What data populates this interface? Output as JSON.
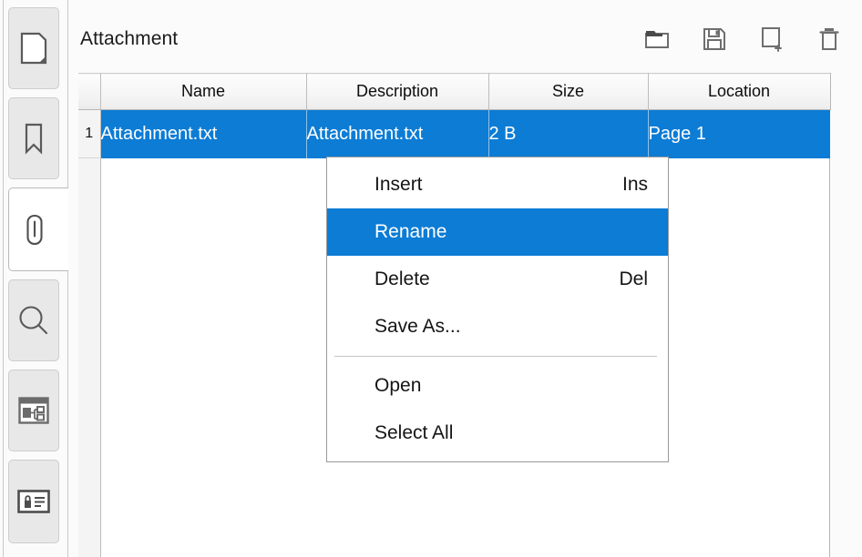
{
  "sidebar": {
    "tabs": [
      {
        "name": "page-thumbnails-tab",
        "icon": "page-icon",
        "label": "Page Thumbnails",
        "active": false
      },
      {
        "name": "bookmarks-tab",
        "icon": "bookmark-icon",
        "label": "Bookmarks",
        "active": false
      },
      {
        "name": "attachments-tab",
        "icon": "paperclip-icon",
        "label": "Attachments",
        "active": true
      },
      {
        "name": "search-tab",
        "icon": "search-icon",
        "label": "Search",
        "active": false
      },
      {
        "name": "layers-tab",
        "icon": "layers-icon",
        "label": "Layers",
        "active": false
      },
      {
        "name": "signatures-tab",
        "icon": "signature-icon",
        "label": "Signatures",
        "active": false
      }
    ]
  },
  "panel": {
    "title": "Attachment"
  },
  "toolbar": {
    "buttons": [
      {
        "name": "open-attachment-button",
        "icon": "open-folder-icon",
        "label": "Open"
      },
      {
        "name": "save-attachment-button",
        "icon": "save-floppy-icon",
        "label": "Save"
      },
      {
        "name": "add-attachment-button",
        "icon": "page-plus-icon",
        "label": "Add"
      },
      {
        "name": "delete-attachment-button",
        "icon": "trash-icon",
        "label": "Delete"
      }
    ]
  },
  "table": {
    "columns": [
      "Name",
      "Description",
      "Size",
      "Location"
    ],
    "rows": [
      {
        "index": "1",
        "name": "Attachment.txt",
        "description": "Attachment.txt",
        "size": "2 B",
        "location": "Page 1",
        "selected": true
      }
    ]
  },
  "context_menu": {
    "items": [
      {
        "label": "Insert",
        "accel": "Ins",
        "selected": false,
        "separator_after": false
      },
      {
        "label": "Rename",
        "accel": "",
        "selected": true,
        "separator_after": false
      },
      {
        "label": "Delete",
        "accel": "Del",
        "selected": false,
        "separator_after": false
      },
      {
        "label": "Save As...",
        "accel": "",
        "selected": false,
        "separator_after": true
      },
      {
        "label": "Open",
        "accel": "",
        "selected": false,
        "separator_after": false
      },
      {
        "label": "Select All",
        "accel": "",
        "selected": false,
        "separator_after": false
      }
    ]
  },
  "colors": {
    "selection_blue": "#0c7cd5",
    "panel_bg": "#fbfbfb",
    "tab_inactive": "#e8e8e8",
    "icon_gray": "#5a5a5a"
  }
}
